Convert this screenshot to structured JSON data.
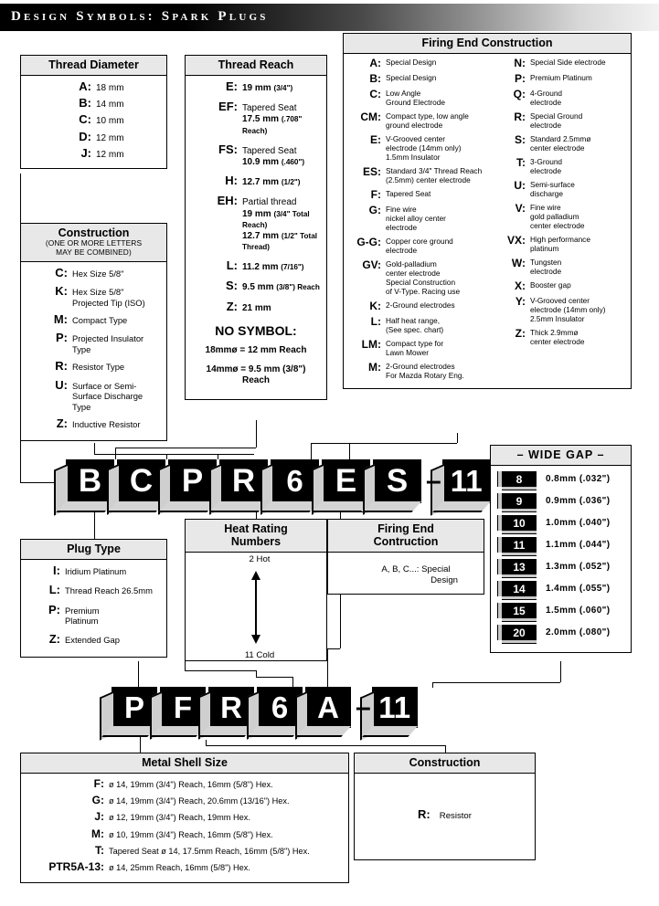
{
  "header": {
    "title": "Design Symbols: Spark Plugs"
  },
  "thread_diameter": {
    "title": "Thread Diameter",
    "rows": [
      {
        "key": "A:",
        "value": "18 mm"
      },
      {
        "key": "B:",
        "value": "14 mm"
      },
      {
        "key": "C:",
        "value": "10 mm"
      },
      {
        "key": "D:",
        "value": "12 mm"
      },
      {
        "key": "J:",
        "value": "12 mm"
      }
    ]
  },
  "thread_reach": {
    "title": "Thread Reach",
    "rows": [
      {
        "key": "E:",
        "l1": "19 mm",
        "l1s": "(3/4\")"
      },
      {
        "key": "EF:",
        "l1": "Tapered Seat",
        "l2": "17.5 mm",
        "l2s": "(.708\" Reach)"
      },
      {
        "key": "FS:",
        "l1": "Tapered Seat",
        "l2": "10.9 mm",
        "l2s": "(.460\")"
      },
      {
        "key": "H:",
        "l1": "12.7 mm",
        "l1s": "(1/2\")"
      },
      {
        "key": "EH:",
        "l1": "Partial thread",
        "l2": "19 mm",
        "l2s": "(3/4\" Total Reach)",
        "l3": "12.7 mm",
        "l3s": "(1/2\" Total Thread)"
      },
      {
        "key": "L:",
        "l1": "11.2 mm",
        "l1s": "(7/16\")"
      },
      {
        "key": "S:",
        "l1": "9.5 mm",
        "l1s": "(3/8\") Reach"
      },
      {
        "key": "Z:",
        "l1": "21 mm"
      }
    ],
    "no_symbol_title": "NO SYMBOL:",
    "no_symbol_1": "18mmø = 12 mm Reach",
    "no_symbol_2a": "14mmø = 9.5 mm (3/8\")",
    "no_symbol_2b": "Reach"
  },
  "construction": {
    "title": "Construction",
    "subtitle_1": "(ONE OR MORE LETTERS",
    "subtitle_2": "MAY BE COMBINED)",
    "rows": [
      {
        "key": "C:",
        "l1": "Hex Size 5/8\""
      },
      {
        "key": "K:",
        "l1": "Hex Size 5/8\"",
        "l2": "Projected Tip (ISO)"
      },
      {
        "key": "M:",
        "l1": "Compact Type"
      },
      {
        "key": "P:",
        "l1": "Projected Insulator",
        "l2": "Type"
      },
      {
        "key": "R:",
        "l1": "Resistor Type"
      },
      {
        "key": "U:",
        "l1": "Surface or Semi-",
        "l2": "Surface Discharge",
        "l3": "Type"
      },
      {
        "key": "Z:",
        "l1": "Inductive Resistor"
      }
    ]
  },
  "firing_end": {
    "title": "Firing End Construction",
    "left": [
      {
        "key": "A:",
        "l1": "Special Design"
      },
      {
        "key": "B:",
        "l1": "Special Design"
      },
      {
        "key": "C:",
        "l1": "Low Angle",
        "l2": "Ground Electrode"
      },
      {
        "key": "CM:",
        "l1": "Compact type, low angle",
        "l2": "ground electrode"
      },
      {
        "key": "E:",
        "l1": "V-Grooved center",
        "l2": "electrode (14mm only)",
        "l3": "1.5mm Insulator"
      },
      {
        "key": "ES:",
        "l1": "Standard 3/4\" Thread Reach",
        "l2": "(2.5mm) center electrode"
      },
      {
        "key": "F:",
        "l1": "Tapered Seat"
      },
      {
        "key": "G:",
        "l1": "Fine wire",
        "l2": "nickel alloy center",
        "l3": "electrode"
      },
      {
        "key": "G-G:",
        "l1": "Copper core ground electrode"
      },
      {
        "key": "GV:",
        "l1": "Gold-palladium",
        "l2": "center electrode",
        "l3": "Special Construction",
        "l4": "of V-Type. Racing use"
      },
      {
        "key": "K:",
        "l1": "2-Ground electrodes"
      },
      {
        "key": "L:",
        "l1": "Half heat range,",
        "l2": "(See spec. chart)"
      },
      {
        "key": "LM:",
        "l1": "Compact type for",
        "l2": "Lawn Mower"
      },
      {
        "key": "M:",
        "l1": "2-Ground electrodes",
        "l2": "For Mazda Rotary Eng."
      }
    ],
    "right": [
      {
        "key": "N:",
        "l1": "Special Side electrode"
      },
      {
        "key": "P:",
        "l1": "Premium Platinum"
      },
      {
        "key": "Q:",
        "l1": "4-Ground",
        "l2": "electrode"
      },
      {
        "key": "R:",
        "l1": "Special Ground",
        "l2": "electrode"
      },
      {
        "key": "S:",
        "l1": "Standard 2.5mmø",
        "l2": "center electrode"
      },
      {
        "key": "T:",
        "l1": "3-Ground",
        "l2": "electrode"
      },
      {
        "key": "U:",
        "l1": "Semi-surface",
        "l2": "discharge"
      },
      {
        "key": "V:",
        "l1": "Fine wire",
        "l2": "gold palladium",
        "l3": "center electrode"
      },
      {
        "key": "VX:",
        "l1": "High performance",
        "l2": "platinum"
      },
      {
        "key": "W:",
        "l1": "Tungsten",
        "l2": "electrode"
      },
      {
        "key": "X:",
        "l1": "Booster gap"
      },
      {
        "key": "Y:",
        "l1": "V-Grooved center",
        "l2": "electrode (14mm only)",
        "l3": "2.5mm Insulator"
      },
      {
        "key": "Z:",
        "l1": "Thick 2.9mmø",
        "l2": "center electrode"
      }
    ]
  },
  "wide_gap": {
    "title": "– WIDE GAP –",
    "rows": [
      {
        "code": "8",
        "value": "0.8mm (.032\")"
      },
      {
        "code": "9",
        "value": "0.9mm (.036\")"
      },
      {
        "code": "10",
        "value": "1.0mm (.040\")"
      },
      {
        "code": "11",
        "value": "1.1mm (.044\")"
      },
      {
        "code": "13",
        "value": "1.3mm (.052\")"
      },
      {
        "code": "14",
        "value": "1.4mm (.055\")"
      },
      {
        "code": "15",
        "value": "1.5mm (.060\")"
      },
      {
        "code": "20",
        "value": "2.0mm (.080\")"
      }
    ]
  },
  "part_code_1": {
    "tiles": [
      "B",
      "C",
      "P",
      "R",
      "6",
      "E",
      "S"
    ],
    "separator": "–",
    "suffix": "11"
  },
  "part_code_2": {
    "tiles": [
      "P",
      "F",
      "R",
      "6",
      "A"
    ],
    "separator": "–",
    "suffix": "11"
  },
  "plug_type": {
    "title": "Plug Type",
    "rows": [
      {
        "key": "I:",
        "l1": "Iridium Platinum"
      },
      {
        "key": "L:",
        "l1": "Thread Reach 26.5mm"
      },
      {
        "key": "P:",
        "l1": "Premium",
        "l2": "Platinum"
      },
      {
        "key": "Z:",
        "l1": "Extended Gap"
      }
    ]
  },
  "heat_rating": {
    "title_1": "Heat Rating",
    "title_2": "Numbers",
    "hot": "2 Hot",
    "cold": "11 Cold"
  },
  "firing_end_small": {
    "title_1": "Firing End",
    "title_2": "Contruction",
    "line_1": "A, B, C...: Special",
    "line_2": "Design"
  },
  "metal_shell": {
    "title": "Metal Shell Size",
    "rows": [
      {
        "key": "F:",
        "value": "ø 14, 19mm (3/4\") Reach, 16mm (5/8\") Hex."
      },
      {
        "key": "G:",
        "value": "ø 14, 19mm (3/4\") Reach, 20.6mm (13/16\") Hex."
      },
      {
        "key": "J:",
        "value": "ø 12, 19mm (3/4\") Reach, 19mm Hex."
      },
      {
        "key": "M:",
        "value": "ø 10, 19mm (3/4\") Reach, 16mm (5/8\") Hex."
      },
      {
        "key": "T:",
        "value": "Tapered Seat  ø 14, 17.5mm Reach, 16mm (5/8\") Hex."
      },
      {
        "key": "PTR5A-13:",
        "value": "ø 14, 25mm Reach, 16mm (5/8\") Hex."
      }
    ]
  },
  "construction_2": {
    "title": "Construction",
    "rows": [
      {
        "key": "R:",
        "value": "Resistor"
      }
    ]
  },
  "colors": {
    "panel_header_bg": "#e8e8e8",
    "tile_bg": "#000000",
    "tile_text": "#ffffff",
    "tile_side": "#cfcfcf"
  }
}
